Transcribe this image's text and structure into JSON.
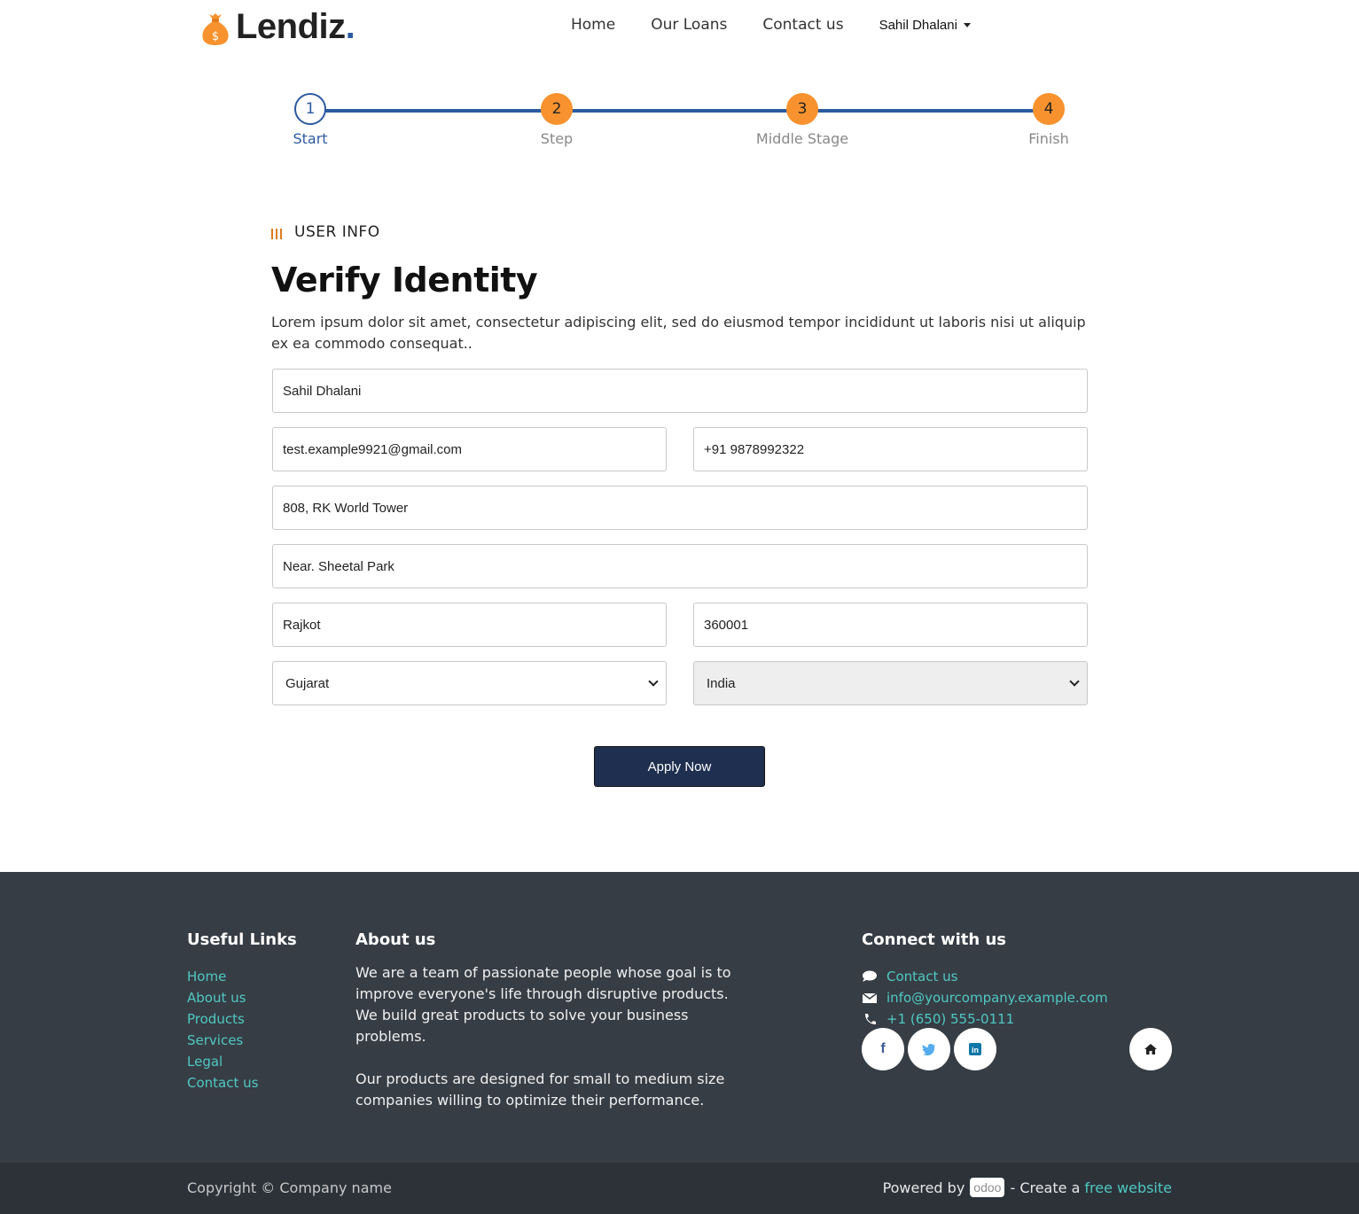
{
  "brand": {
    "name": "Lendiz",
    "dot": "."
  },
  "nav": {
    "items": [
      "Home",
      "Our Loans",
      "Contact us"
    ],
    "user": "Sahil Dhalani"
  },
  "stepper": [
    {
      "number": "1",
      "label": "Start",
      "state": "current"
    },
    {
      "number": "2",
      "label": "Step",
      "state": "pending"
    },
    {
      "number": "3",
      "label": "Middle Stage",
      "state": "pending"
    },
    {
      "number": "4",
      "label": "Finish",
      "state": "pending"
    }
  ],
  "section": {
    "tag": "USER INFO",
    "title": "Verify Identity",
    "intro": "Lorem ipsum dolor sit amet, consectetur adipiscing elit, sed do eiusmod tempor incididunt ut laboris nisi ut aliquip ex ea commodo consequat.."
  },
  "form": {
    "name": "Sahil Dhalani",
    "email": "test.example9921@gmail.com",
    "phone": "+91 9878992322",
    "address1": "808, RK World Tower",
    "address2": "Near. Sheetal Park",
    "city": "Rajkot",
    "zip": "360001",
    "state": "Gujarat",
    "country": "India",
    "submit": "Apply Now"
  },
  "footer": {
    "useful_links_title": "Useful Links",
    "useful_links": [
      "Home",
      "About us",
      "Products",
      "Services",
      "Legal",
      "Contact us"
    ],
    "about_title": "About us",
    "about_p1": "We are a team of passionate people whose goal is to improve everyone's life through disruptive products. We build great products to solve your business problems.",
    "about_p2": "Our products are designed for small to medium size companies willing to optimize their performance.",
    "connect_title": "Connect with us",
    "contact_link": "Contact us",
    "email": "info@yourcompany.example.com",
    "phone": "+1 (650) 555-0111",
    "copyright": "Copyright © Company name",
    "powered_by": "Powered by",
    "odoo": "odoo",
    "create_text": "- Create a",
    "free_website": "free website"
  },
  "colors": {
    "accent": "#f7922e",
    "primary": "#2c5aa0",
    "link": "#4ec9c1",
    "footer_bg": "#373d45",
    "button_bg": "#1f2f4f"
  }
}
